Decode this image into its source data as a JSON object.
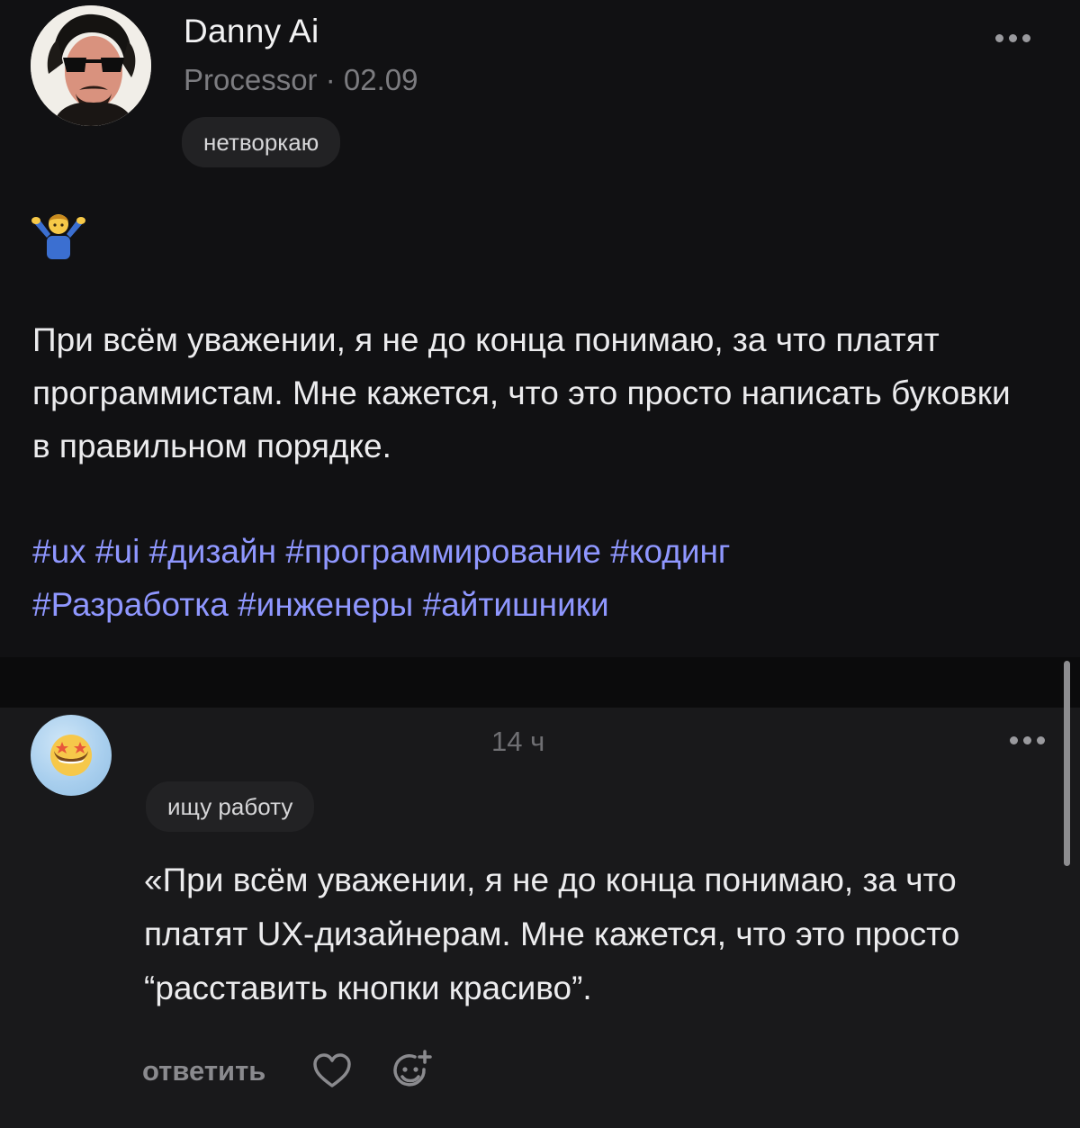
{
  "post": {
    "author": {
      "name": "Danny Ai",
      "meta": "Processor · 02.09"
    },
    "status_chip": "нетворкаю",
    "reaction_emoji": "shrug-emoji",
    "text": "При всём уважении, я не до конца понимаю, за что платят программистам. Мне кажется, что это просто написать буковки в правильном порядке.",
    "hashtags": [
      "#ux",
      "#ui",
      "#дизайн",
      "#программирование",
      "#кодинг",
      "#Разработка",
      "#инженеры",
      "#айтишники"
    ],
    "more_icon": "more-dots-icon"
  },
  "comment": {
    "time": "14 ч",
    "status_chip": "ищу работу",
    "text": "«При всём уважении, я не до конца понимаю, за что платят UX-дизайнерам. Мне кажется, что это просто “расставить кнопки красиво”.",
    "reply_label": "ответить",
    "like_icon": "heart-icon",
    "react_icon": "add-reaction-icon",
    "avatar_emoji": "star-struck-emoji"
  },
  "colors": {
    "background": "#111113",
    "comment_background": "#19191b",
    "hashtag": "#8f97ff",
    "secondary_text": "#7c7c80",
    "chip_background": "#222224"
  }
}
